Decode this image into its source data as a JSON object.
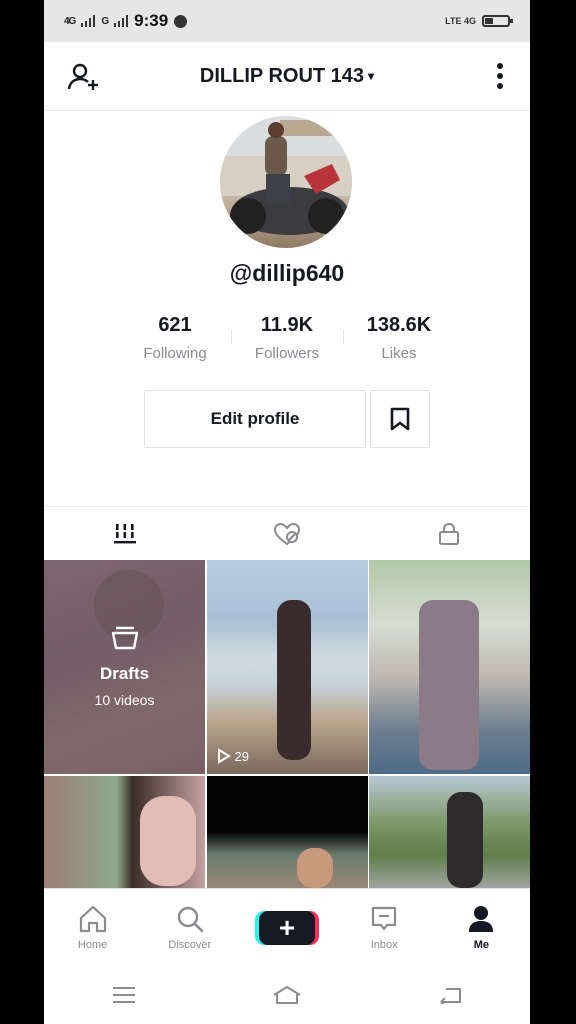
{
  "status_bar": {
    "sim1": "4G",
    "sim2": "G",
    "time": "9:39",
    "network": "LTE 4G"
  },
  "header": {
    "title": "DILLIP ROUT 143",
    "caret": "▾"
  },
  "profile": {
    "username": "@dillip640",
    "stats": [
      {
        "value": "621",
        "label": "Following"
      },
      {
        "value": "11.9K",
        "label": "Followers"
      },
      {
        "value": "138.6K",
        "label": "Likes"
      }
    ],
    "edit_profile_label": "Edit profile"
  },
  "tabs": [
    {
      "icon": "videos-grid-icon"
    },
    {
      "icon": "liked-videos-icon"
    },
    {
      "icon": "private-lock-icon"
    }
  ],
  "grid": {
    "drafts": {
      "title": "Drafts",
      "count": "10 videos"
    },
    "video2_plays": "29"
  },
  "bottom_nav": [
    {
      "label": "Home",
      "icon": "home-icon"
    },
    {
      "label": "Discover",
      "icon": "search-icon"
    },
    {
      "label": "",
      "icon": "create-plus-icon",
      "symbol": "+"
    },
    {
      "label": "Inbox",
      "icon": "inbox-icon"
    },
    {
      "label": "Me",
      "icon": "profile-icon"
    }
  ],
  "battery_level": 0.35,
  "colors": {
    "accent_cyan": "#24f6f0",
    "accent_red": "#fe2c55",
    "text_primary": "#161823",
    "text_secondary": "#8a8b91"
  }
}
